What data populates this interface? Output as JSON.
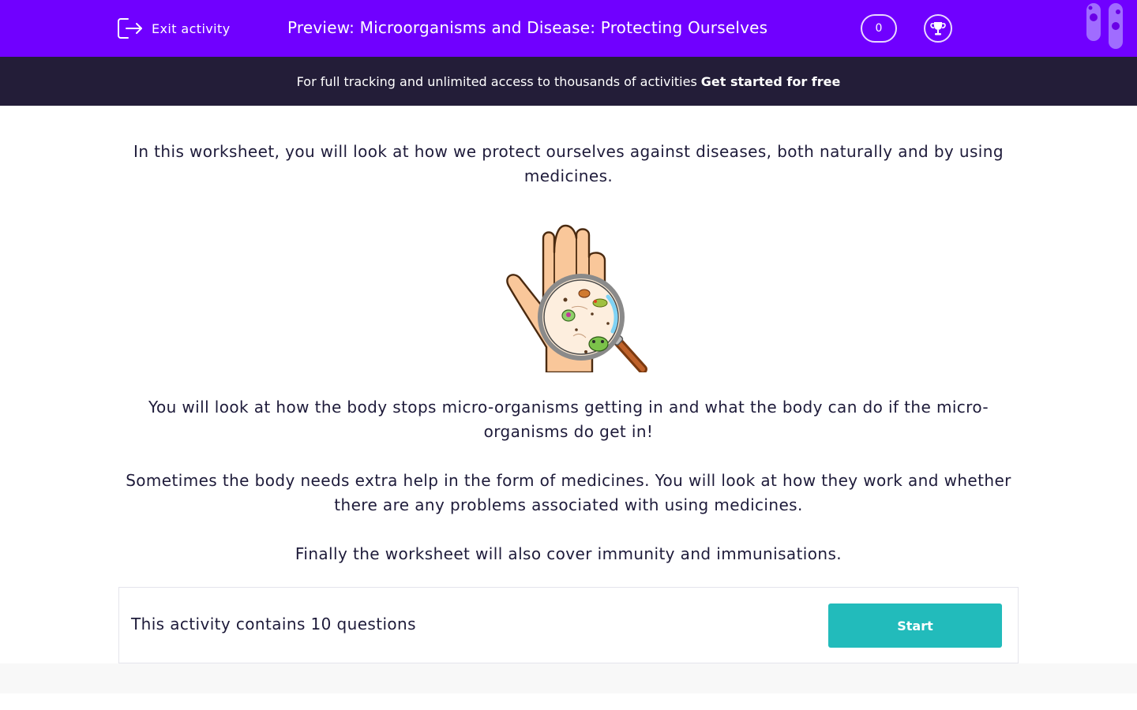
{
  "header": {
    "exit_label": "Exit activity",
    "title": "Preview: Microorganisms and Disease: Protecting Ourselves",
    "score": "0"
  },
  "banner": {
    "text": "For full tracking and unlimited access to thousands of activities",
    "cta": "Get started for free"
  },
  "intro": {
    "paragraph_1": "In this worksheet, you will look at how we protect ourselves against diseases, both naturally and by using medicines.",
    "paragraph_2": "You will look at how the body stops micro-organisms getting in and what the body can do if the micro-organisms do get in!",
    "paragraph_3": "Sometimes the body needs extra help in the form of medicines. You will look at how they work and whether there are any problems associated with using medicines.",
    "paragraph_4": "Finally the worksheet will also cover immunity and immunisations."
  },
  "activity": {
    "summary": "This activity contains 10 questions",
    "start_label": "Start"
  },
  "colors": {
    "topbar": "#7000ff",
    "banner": "#231d38",
    "start_button": "#22bbbb",
    "text": "#1e1b3a"
  },
  "icons": {
    "exit": "exit-icon",
    "trophy": "trophy-icon",
    "decor": "test-tubes-icon",
    "hero": "hand-magnifier-image"
  }
}
